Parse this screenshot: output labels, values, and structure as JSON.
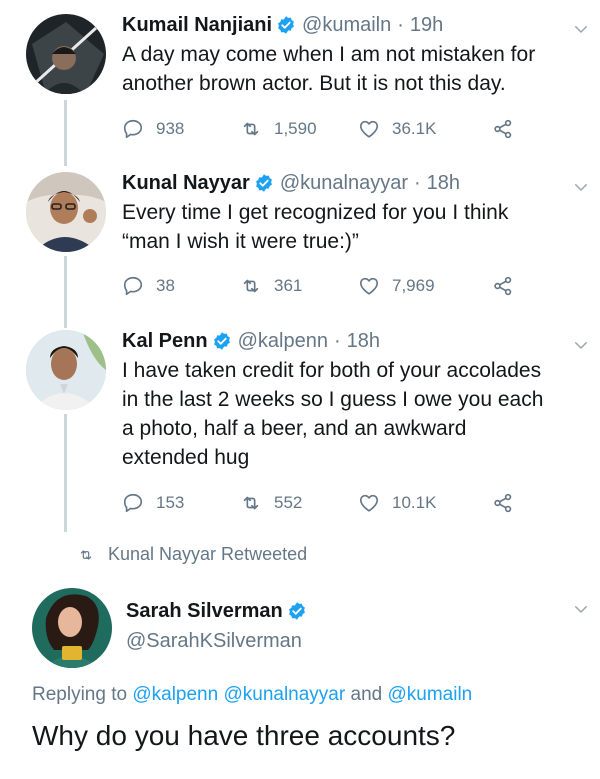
{
  "tweets": [
    {
      "name": "Kumail Nanjiani",
      "handle": "@kumailn",
      "separator": "·",
      "time": "19h",
      "text_lines": [
        "A day may come when I am not mistaken for",
        "another brown actor. But it is not this day."
      ],
      "replies": "938",
      "retweets": "1,590",
      "likes": "36.1K"
    },
    {
      "name": "Kunal Nayyar",
      "handle": "@kunalnayyar",
      "separator": "·",
      "time": "18h",
      "text_lines": [
        "Every time I get recognized for you I think",
        "“man I wish it were true:)”"
      ],
      "replies": "38",
      "retweets": "361",
      "likes": "7,969"
    },
    {
      "name": "Kal Penn",
      "handle": "@kalpenn",
      "separator": "·",
      "time": "18h",
      "text_lines": [
        "I have taken credit for both of your accolades",
        "in the last 2 weeks so I guess I owe you each",
        "a photo, half a beer, and an awkward",
        "extended hug"
      ],
      "replies": "153",
      "retweets": "552",
      "likes": "10.1K"
    }
  ],
  "retweet_banner": "Kunal Nayyar Retweeted",
  "focus_tweet": {
    "name": "Sarah Silverman",
    "handle": "@SarahKSilverman",
    "replying_prefix": "Replying to",
    "mentions": [
      "@kalpenn",
      "@kunalnayyar"
    ],
    "and_word": "and",
    "last_mention": "@kumailn",
    "text": "Why do you have three accounts?"
  },
  "colors": {
    "link_blue": "#1da1f2",
    "muted_gray": "#657786",
    "text_dark": "#14171a",
    "verified_blue": "#1da1f2"
  },
  "icons": [
    "verified-badge-icon",
    "chevron-down-icon",
    "reply-icon",
    "retweet-icon",
    "like-icon",
    "share-icon"
  ]
}
